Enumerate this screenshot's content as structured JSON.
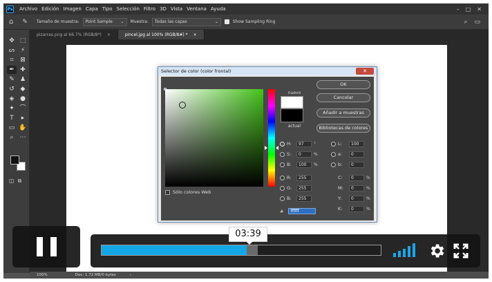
{
  "app": {
    "menu": [
      "Archivo",
      "Edición",
      "Imagen",
      "Capa",
      "Tipo",
      "Selección",
      "Filtro",
      "3D",
      "Vista",
      "Ventana",
      "Ayuda"
    ],
    "logo": "Ps"
  },
  "options_bar": {
    "sample_size_label": "Tamaño de muestra:",
    "sample_size_value": "Point Sample",
    "sample_label": "Muestra:",
    "sample_value": "Todas las capas",
    "show_ring_label": "Show Sampling Ring"
  },
  "tabs": [
    {
      "label": "pizarras.png al 66.7% (RGB/8*)",
      "close": "×"
    },
    {
      "label": "pincel.jpg al 100% (RGB/8#) *",
      "close": "×"
    }
  ],
  "statusbar": {
    "zoom": "100%",
    "doc": "Doc: 1.72 MB/0 bytes",
    "arrow": "›"
  },
  "color_picker": {
    "title": "Selector de color (color frontal)",
    "close_glyph": "✕",
    "new_label": "nuevo",
    "current_label": "actual",
    "web_only_label": "Sólo colores Web",
    "buttons": {
      "ok": "OK",
      "cancel": "Cancelar",
      "add_swatches": "Añadir a muestras",
      "libraries": "Bibliotecas de colores"
    },
    "hsb": {
      "h": {
        "label": "H:",
        "value": "97",
        "unit": "°"
      },
      "s": {
        "label": "S:",
        "value": "0",
        "unit": "%"
      },
      "b": {
        "label": "B:",
        "value": "100",
        "unit": "%"
      }
    },
    "lab": {
      "l": {
        "label": "L:",
        "value": "100"
      },
      "a": {
        "label": "a:",
        "value": "0"
      },
      "b": {
        "label": "b:",
        "value": "0"
      }
    },
    "rgb": {
      "r": {
        "label": "R:",
        "value": "255"
      },
      "g": {
        "label": "G:",
        "value": "255"
      },
      "b": {
        "label": "B:",
        "value": "255"
      }
    },
    "cmyk": {
      "c": {
        "label": "C:",
        "value": "0",
        "unit": "%"
      },
      "m": {
        "label": "M:",
        "value": "0",
        "unit": "%"
      },
      "y": {
        "label": "Y:",
        "value": "0",
        "unit": "%"
      },
      "k": {
        "label": "K:",
        "value": "0",
        "unit": "%"
      }
    },
    "hex": {
      "label": "#",
      "value": "ffffff"
    }
  },
  "video": {
    "time_tooltip": "03:39",
    "progress_fraction": 0.52,
    "buffered_fraction": 0.56,
    "accent": "#14a7e6"
  }
}
